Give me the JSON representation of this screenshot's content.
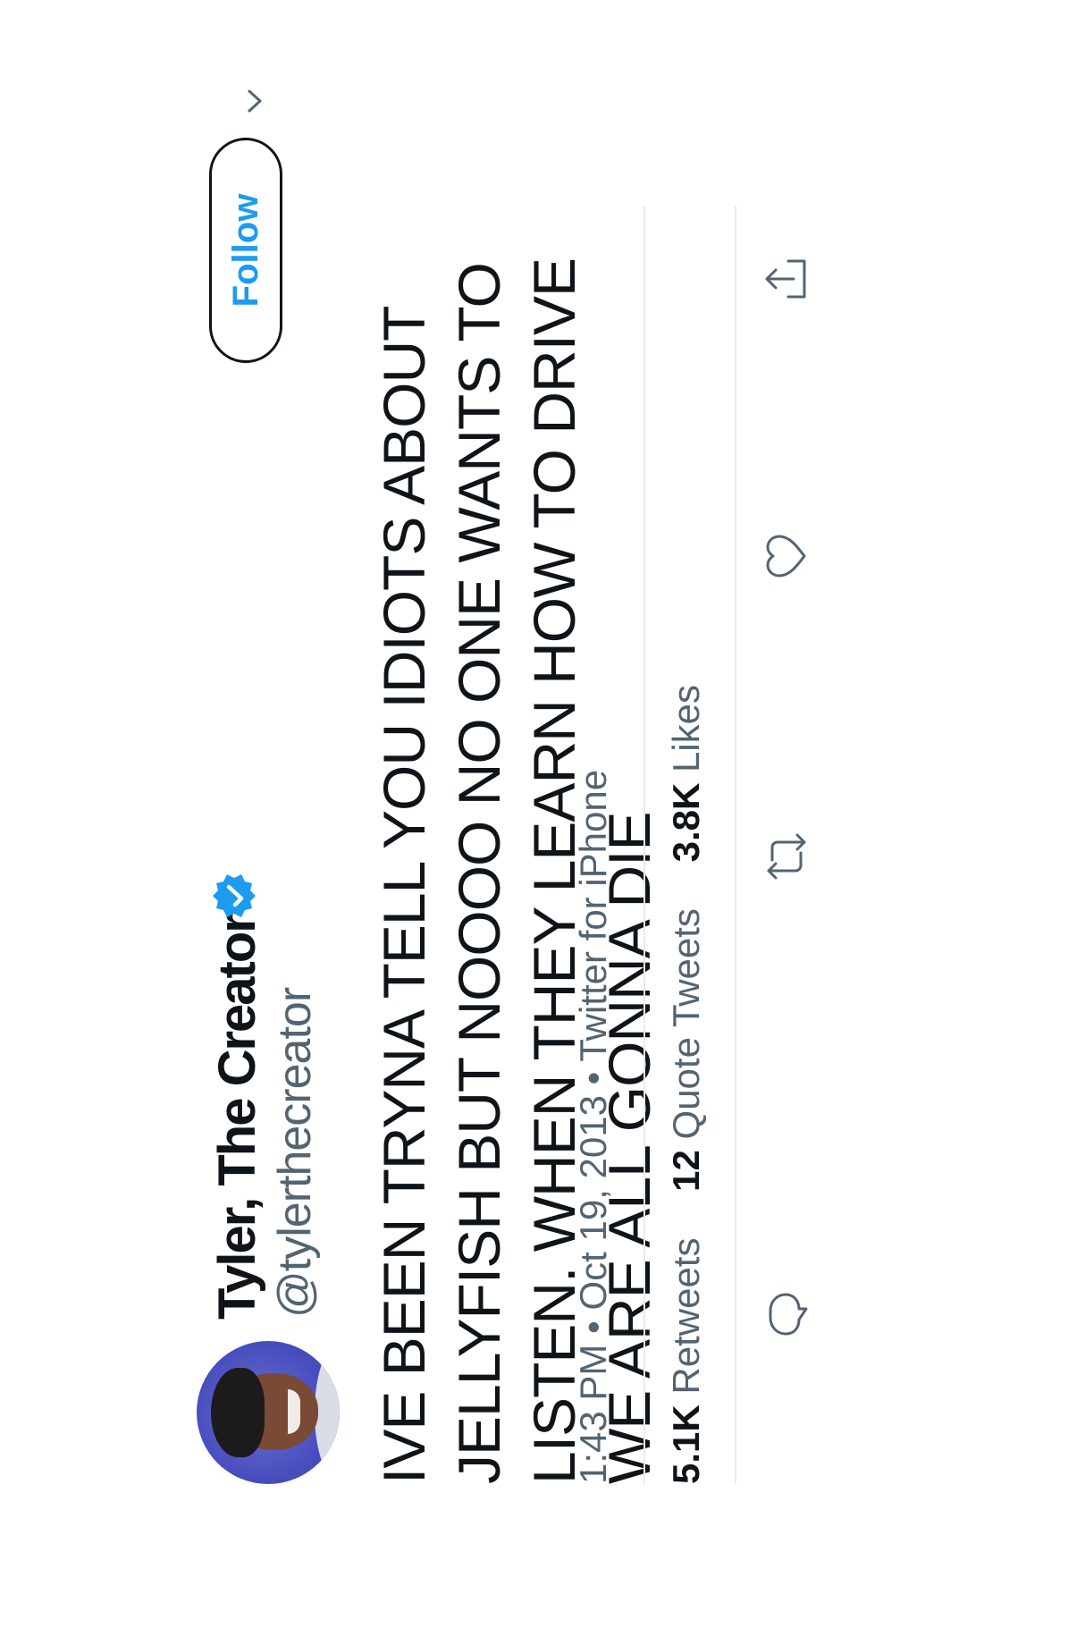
{
  "author": {
    "display_name": "Tyler, The Creator",
    "handle": "@tylerthecreator",
    "verified_icon": "verified-badge-icon"
  },
  "follow_button": {
    "label": "Follow"
  },
  "tweet": {
    "text": "IVE BEEN TRYNA TELL YOU IDIOTS ABOUT JELLYFISH BUT NOOOO NO ONE WANTS TO LISTEN. WHEN THEY LEARN HOW TO DRIVE WE ARE ALL GONNA DIE",
    "time": "1:43 PM",
    "date": "Oct 19, 2013",
    "separator": "•",
    "source": "Twitter for iPhone"
  },
  "stats": {
    "retweets": {
      "count": "5.1K",
      "label": "Retweets"
    },
    "quote_tweets": {
      "count": "12",
      "label": "Quote Tweets"
    },
    "likes": {
      "count": "3.8K",
      "label": "Likes"
    }
  },
  "actions": {
    "reply_icon": "reply-icon",
    "retweet_icon": "retweet-icon",
    "like_icon": "heart-icon",
    "share_icon": "share-icon"
  },
  "colors": {
    "accent": "#1d9bf0",
    "text": "#0f1419",
    "secondary": "#536471",
    "divider": "#e6ecf0"
  }
}
